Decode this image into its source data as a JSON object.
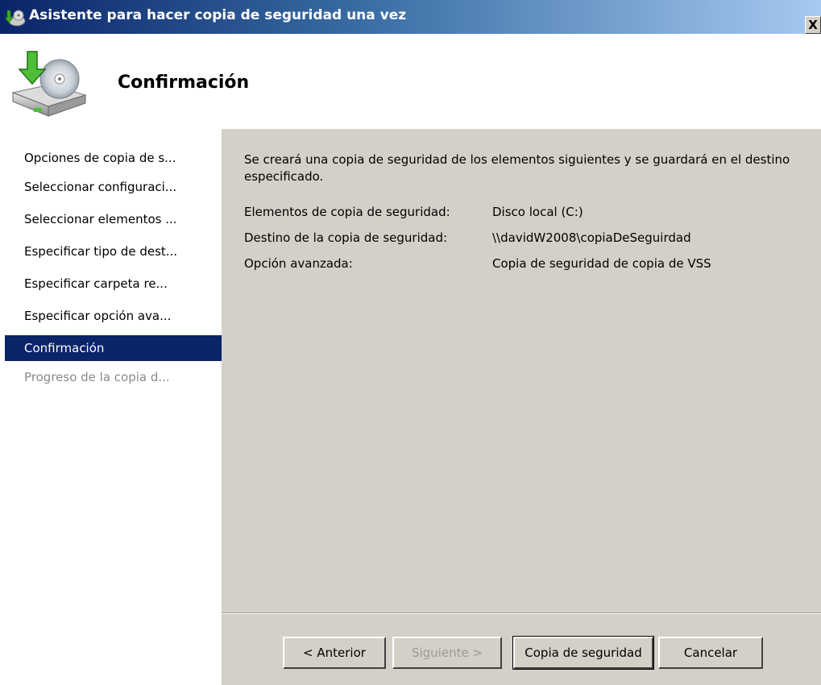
{
  "window": {
    "title": "Asistente para hacer copia de seguridad una vez",
    "close_label": "X"
  },
  "header": {
    "title": "Confirmación"
  },
  "sidebar": {
    "items": [
      {
        "label": "Opciones de copia de s...",
        "state": "normal"
      },
      {
        "label": "Seleccionar configuraci...",
        "state": "normal"
      },
      {
        "label": "Seleccionar elementos ...",
        "state": "normal"
      },
      {
        "label": "Especificar tipo de dest...",
        "state": "normal"
      },
      {
        "label": "Especificar carpeta re...",
        "state": "normal"
      },
      {
        "label": "Especificar opción ava...",
        "state": "normal"
      },
      {
        "label": "Confirmación",
        "state": "active"
      },
      {
        "label": "Progreso de la copia d...",
        "state": "disabled"
      }
    ]
  },
  "main": {
    "intro": "Se creará una copia de seguridad de los elementos siguientes y se guardará en el destino especificado.",
    "details": [
      {
        "label": "Elementos de copia de seguridad:",
        "value": "Disco local (C:)"
      },
      {
        "label": "Destino de la copia de seguridad:",
        "value": "\\\\davidW2008\\copiaDeSeguirdad"
      },
      {
        "label": "Opción avanzada:",
        "value": "Copia de seguridad de copia de VSS"
      }
    ]
  },
  "buttons": {
    "back": "< Anterior",
    "next": "Siguiente >",
    "backup": "Copia de seguridad",
    "cancel": "Cancelar"
  },
  "colors": {
    "selection": "#0a246a",
    "dialog_face": "#d4d0c8",
    "disabled_text": "#8a8a8a"
  }
}
